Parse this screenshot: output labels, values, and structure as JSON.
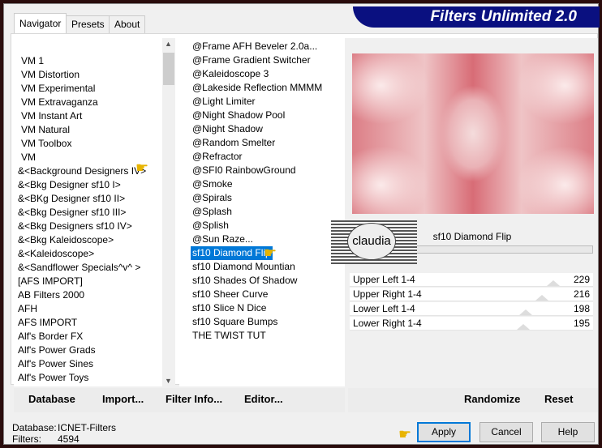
{
  "title": "Filters Unlimited 2.0",
  "tabs": [
    "Navigator",
    "Presets",
    "About"
  ],
  "categories": [
    "VM 1",
    "VM Distortion",
    "VM Experimental",
    "VM Extravaganza",
    "VM Instant Art",
    "VM Natural",
    "VM Toolbox",
    "VM",
    "&<Background Designers IV>",
    "&<Bkg Designer sf10 I>",
    "&<BKg Designer sf10 II>",
    "&<Bkg Designer sf10 III>",
    "&<Bkg Designers sf10 IV>",
    "&<Bkg Kaleidoscope>",
    "&<Kaleidoscope>",
    "&<Sandflower Specials^v^ >",
    "[AFS IMPORT]",
    "AB Filters 2000",
    "AFH",
    "AFS IMPORT",
    "Alf's Border FX",
    "Alf's Power Grads",
    "Alf's Power Sines",
    "Alf's Power Toys"
  ],
  "filters": [
    "@Frame AFH Beveler 2.0a...",
    "@Frame Gradient Switcher",
    "@Kaleidoscope 3",
    "@Lakeside Reflection MMMM",
    "@Light Limiter",
    "@Night Shadow Pool",
    "@Night Shadow",
    "@Random Smelter",
    "@Refractor",
    "@SFI0 RainbowGround",
    "@Smoke",
    "@Spirals",
    "@Splash",
    "@Splish",
    "@Sun Raze...",
    "sf10 Diamond Flip",
    "sf10 Diamond Mountian",
    "sf10 Shades Of Shadow",
    "sf10 Sheer Curve",
    "sf10 Slice N Dice",
    "sf10 Square Bumps",
    "THE TWIST TUT"
  ],
  "selected_filter_index": 15,
  "selected_category_index": 8,
  "filter_name": "sf10 Diamond Flip",
  "watermark": "claudia",
  "sliders": [
    {
      "label": "Upper Left 1-4",
      "value": 229
    },
    {
      "label": "Upper Right 1-4",
      "value": 216
    },
    {
      "label": "Lower Left 1-4",
      "value": 198
    },
    {
      "label": "Lower Right 1-4",
      "value": 195
    }
  ],
  "slider_max": 255,
  "buttons": {
    "database": "Database",
    "import": "Import...",
    "filter_info": "Filter Info...",
    "editor": "Editor...",
    "randomize": "Randomize",
    "reset": "Reset",
    "apply": "Apply",
    "cancel": "Cancel",
    "help": "Help"
  },
  "status": {
    "db_label": "Database:",
    "db_value": "ICNET-Filters",
    "filters_label": "Filters:",
    "filters_value": "4594"
  },
  "colors": {
    "banner": "#0a1080",
    "selection": "#0078d7"
  }
}
